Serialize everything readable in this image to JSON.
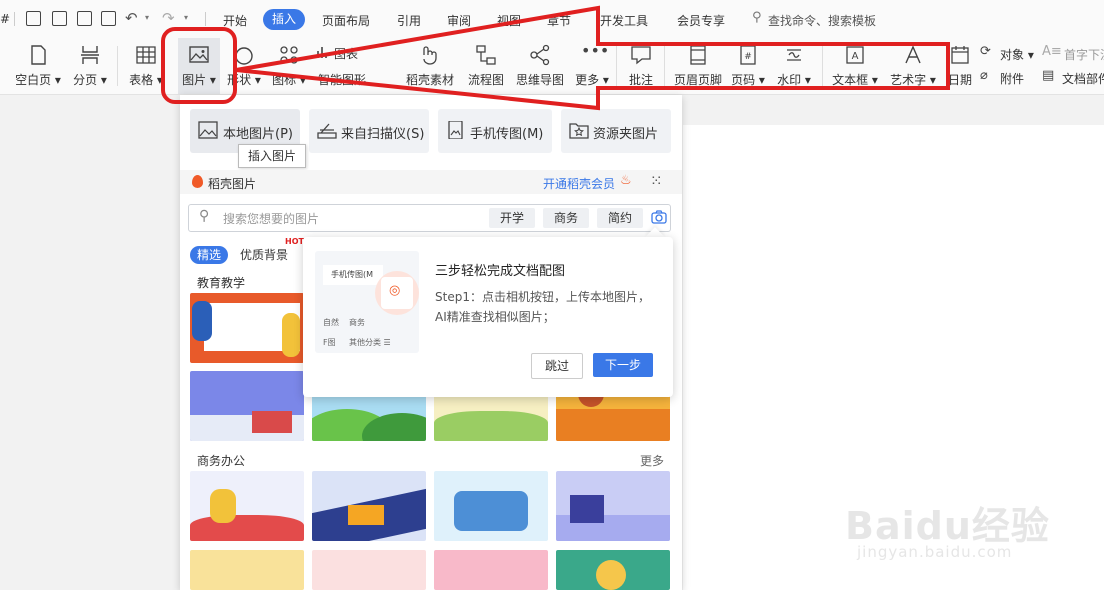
{
  "menubar": {
    "items": [
      "开始",
      "插入",
      "页面布局",
      "引用",
      "审阅",
      "视图",
      "章节",
      "开发工具",
      "会员专享"
    ],
    "active": "插入",
    "search_placeholder": "查找命令、搜索模板"
  },
  "ribbon": {
    "buttons": [
      "空白页",
      "分页",
      "表格",
      "图片",
      "形状",
      "图标",
      "智能图形",
      "稻壳素材",
      "流程图",
      "思维导图",
      "更多",
      "批注",
      "页眉页脚",
      "页码",
      "水印",
      "文本框",
      "艺术字",
      "日期"
    ],
    "chart_label": "图表",
    "right_items": [
      "对象",
      "首字下沉",
      "附件",
      "文档部件"
    ],
    "partial_icon_left": "#"
  },
  "panel": {
    "sources": [
      "本地图片(P)",
      "来自扫描仪(S)",
      "手机传图(M)",
      "资源夹图片"
    ],
    "tooltip": "插入图片",
    "daoke_label": "稻壳图片",
    "vip_link": "开通稻壳会员",
    "search_placeholder": "搜索您想要的图片",
    "search_tags": [
      "开学",
      "商务",
      "简约"
    ],
    "category_tabs": [
      "精选",
      "优质背景"
    ],
    "hot_badge": "HOT",
    "section_education": "教育教学",
    "section_business": "商务办公",
    "more_label": "更多"
  },
  "guide": {
    "title": "三步轻松完成文档配图",
    "body": "Step1：点击相机按钮，上传本地图片，AI精准查找相似图片；",
    "skip": "跳过",
    "next": "下一步",
    "illus_label": "手机传图(M",
    "illus_tags": [
      "自然",
      "商务"
    ],
    "illus_bottom": [
      "F图",
      "其他分类 ☰"
    ]
  },
  "watermark": {
    "brand": "Baidu经验",
    "url": "jingyan.baidu.com"
  },
  "colors": {
    "accent": "#3a78e7",
    "annotation_red": "#e02020",
    "daoke_orange": "#f05a28"
  }
}
